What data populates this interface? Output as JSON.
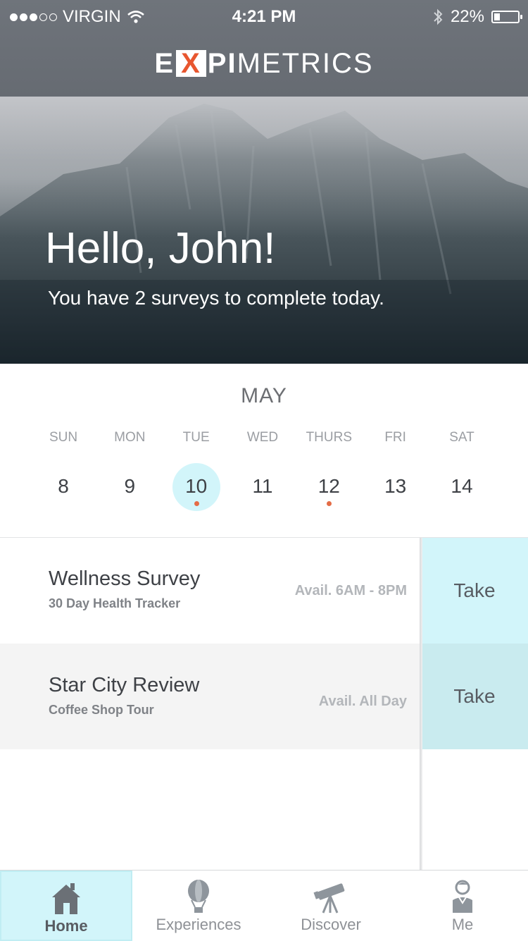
{
  "status_bar": {
    "carrier": "VIRGIN",
    "signal_bars": 3,
    "signal_total": 5,
    "time": "4:21 PM",
    "battery": "22%",
    "battery_level": 0.22
  },
  "app": {
    "logo": {
      "part1": "E",
      "part2": "X",
      "part3": "PI",
      "part4": "METRICS"
    },
    "accent": "#e8562f"
  },
  "hero": {
    "greeting": "Hello, John!",
    "subtitle": "You have 2 surveys to complete today."
  },
  "calendar": {
    "month": "MAY",
    "weekdays": [
      "SUN",
      "MON",
      "TUE",
      "WED",
      "THURS",
      "FRI",
      "SAT"
    ],
    "days": [
      {
        "num": "8",
        "selected": false,
        "event": false
      },
      {
        "num": "9",
        "selected": false,
        "event": false
      },
      {
        "num": "10",
        "selected": true,
        "event": true
      },
      {
        "num": "11",
        "selected": false,
        "event": false
      },
      {
        "num": "12",
        "selected": false,
        "event": true
      },
      {
        "num": "13",
        "selected": false,
        "event": false
      },
      {
        "num": "14",
        "selected": false,
        "event": false
      }
    ],
    "highlight_color": "#d2f5fa",
    "event_color": "#e46c46"
  },
  "surveys": [
    {
      "title": "Wellness Survey",
      "subtitle": "30 Day Health Tracker",
      "availability": "Avail. 6AM - 8PM",
      "action": "Take"
    },
    {
      "title": "Star City Review",
      "subtitle": "Coffee Shop Tour",
      "availability": "Avail. All Day",
      "action": "Take"
    }
  ],
  "tabs": [
    {
      "label": "Home",
      "icon": "house-icon",
      "active": true
    },
    {
      "label": "Experiences",
      "icon": "hot-air-balloon-icon",
      "active": false
    },
    {
      "label": "Discover",
      "icon": "telescope-icon",
      "active": false
    },
    {
      "label": "Me",
      "icon": "person-icon",
      "active": false
    }
  ]
}
